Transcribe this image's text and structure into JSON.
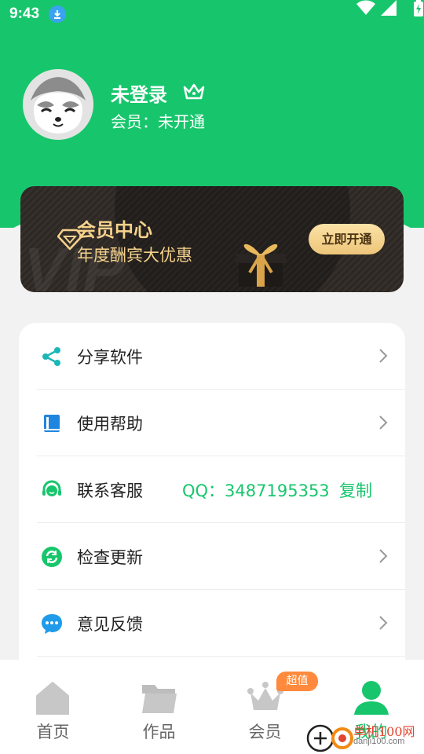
{
  "status_bar": {
    "time": "9:43"
  },
  "profile": {
    "name": "未登录",
    "member_label": "会员：",
    "member_status": "未开通"
  },
  "vip_card": {
    "title": "会员中心",
    "subtitle": "年度酬宾大优惠",
    "button": "立即开通",
    "watermark": "VIP"
  },
  "menu": {
    "items": [
      {
        "label": "分享软件",
        "icon": "share-icon"
      },
      {
        "label": "使用帮助",
        "icon": "book-icon"
      },
      {
        "label": "联系客服",
        "icon": "headset-icon",
        "qq_label": "QQ：3487195353",
        "action": "复制"
      },
      {
        "label": "检查更新",
        "icon": "refresh-icon"
      },
      {
        "label": "意见反馈",
        "icon": "chat-icon"
      }
    ]
  },
  "tabbar": {
    "tabs": [
      {
        "label": "首页",
        "icon": "home-icon"
      },
      {
        "label": "作品",
        "icon": "folder-icon"
      },
      {
        "label": "会员",
        "icon": "crown-icon"
      },
      {
        "label": "我的",
        "icon": "user-icon"
      }
    ],
    "badge": "超值",
    "active_index": 3
  },
  "watermark": {
    "text": "单机100网",
    "url": "danji100.com"
  },
  "colors": {
    "primary": "#17c66c",
    "gold": "#f5d28c",
    "badge": "#ff8a3d"
  }
}
